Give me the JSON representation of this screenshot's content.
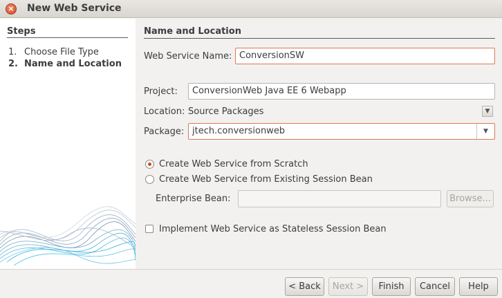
{
  "window": {
    "title": "New Web Service"
  },
  "steps": {
    "title": "Steps",
    "items": [
      {
        "num": "1.",
        "label": "Choose File Type"
      },
      {
        "num": "2.",
        "label": "Name and Location"
      }
    ]
  },
  "form": {
    "section_title": "Name and Location",
    "web_service_name_label": "Web Service Name:",
    "web_service_name_value": "ConversionSW",
    "project_label": "Project:",
    "project_value": "ConversionWeb Java EE 6 Webapp",
    "location_label": "Location:",
    "location_value": "Source Packages",
    "package_label": "Package:",
    "package_value": "jtech.conversionweb",
    "radio_scratch_label": "Create Web Service from Scratch",
    "radio_existing_label": "Create Web Service from Existing Session Bean",
    "enterprise_bean_label": "Enterprise Bean:",
    "enterprise_bean_value": "",
    "browse_label": "Browse...",
    "stateless_checkbox_label": "Implement Web Service as Stateless Session Bean"
  },
  "buttons": {
    "back": "< Back",
    "next": "Next >",
    "finish": "Finish",
    "cancel": "Cancel",
    "help": "Help"
  },
  "colors": {
    "accent": "#d24a21",
    "focus_border": "#e07855"
  }
}
